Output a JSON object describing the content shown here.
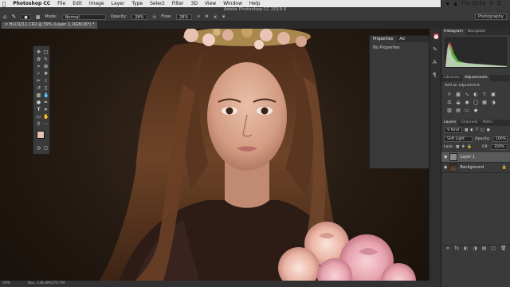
{
  "menu": {
    "apple": "",
    "items": [
      "Photoshop CC",
      "File",
      "Edit",
      "Image",
      "Layer",
      "Type",
      "Select",
      "Filter",
      "3D",
      "View",
      "Window",
      "Help"
    ],
    "clock": "Thu 10:59"
  },
  "options": {
    "app_title": "Adobe Photoshop CC 2019.0",
    "mode_label": "Mode:",
    "mode_value": "Normal",
    "opacity_label": "Opacity:",
    "opacity_value": "28%",
    "flow_label": "Flow:",
    "flow_value": "28%",
    "workspace": "Photography"
  },
  "document": {
    "tab_title": "HLC9211.CR2 @ 59% (Layer 1, RGB/16*) *"
  },
  "status": {
    "zoom": "59%",
    "doc_size": "Doc: 138.4M/270.7M"
  },
  "properties_panel": {
    "tabs": [
      "Properties",
      "Ad"
    ],
    "body_text": "No Properties"
  },
  "histogram_panel": {
    "tabs": [
      "Histogram",
      "Navigator"
    ]
  },
  "adjustments_panel": {
    "tabs": [
      "Libraries",
      "Adjustments"
    ],
    "hint": "Add an adjustment"
  },
  "layers_panel": {
    "tabs": [
      "Layers",
      "Channels",
      "Paths"
    ],
    "filter_value": "Kind",
    "blend_mode": "Soft Light",
    "opacity_label": "Opacity:",
    "opacity_value": "100%",
    "fill_label": "Fill:",
    "fill_value": "100%",
    "lock_label": "Lock:",
    "layers": [
      {
        "name": "Layer 1",
        "selected": true
      },
      {
        "name": "Background",
        "selected": false
      }
    ]
  },
  "colors": {
    "foreground": "#e8c2b0",
    "background": "#ffffff",
    "selected_layer": "#5a5a5a"
  }
}
